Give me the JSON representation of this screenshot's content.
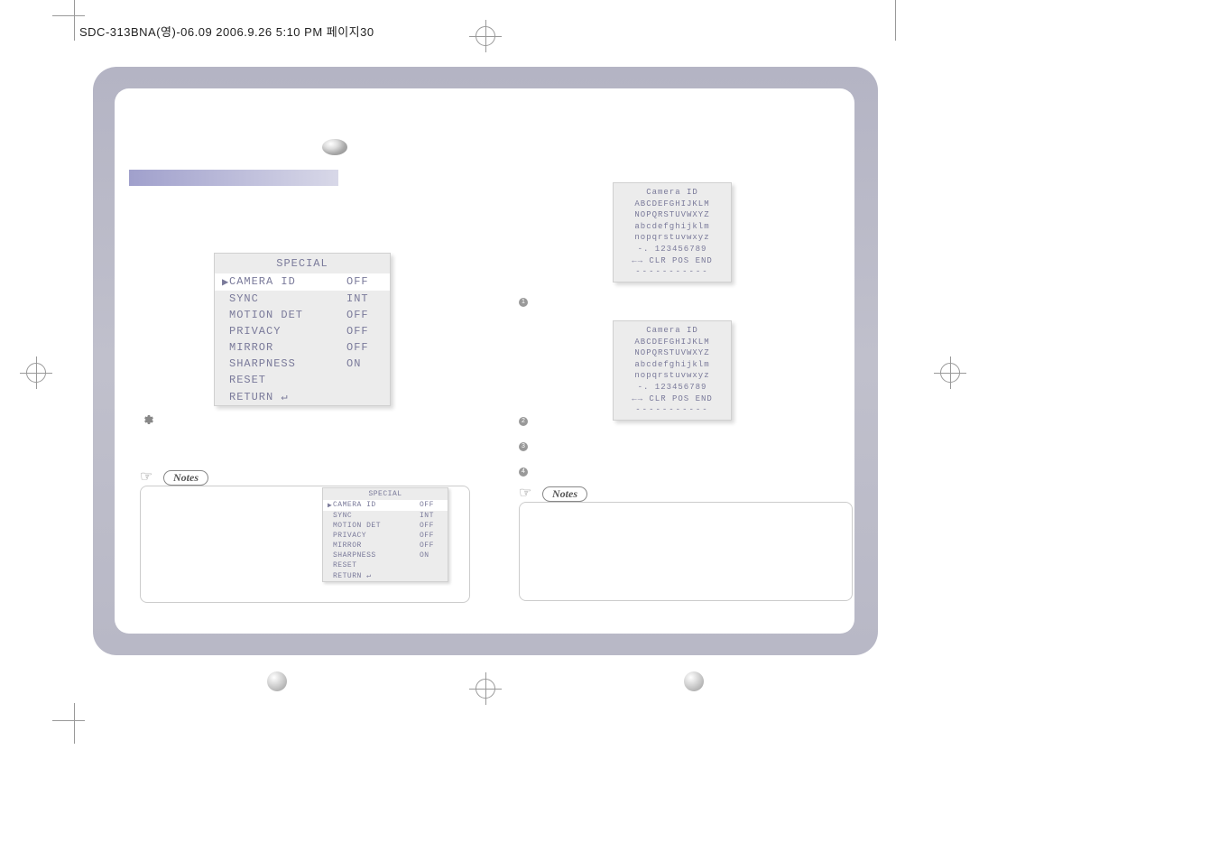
{
  "header": "SDC-313BNA(영)-06.09  2006.9.26 5:10 PM  페이지30",
  "special_menu": {
    "title": "SPECIAL",
    "rows": [
      {
        "label": "CAMERA ID",
        "val": "OFF",
        "selected": true
      },
      {
        "label": "SYNC",
        "val": "INT"
      },
      {
        "label": "MOTION DET",
        "val": "OFF"
      },
      {
        "label": "PRIVACY",
        "val": "OFF"
      },
      {
        "label": "MIRROR",
        "val": "OFF"
      },
      {
        "label": "SHARPNESS",
        "val": "ON"
      },
      {
        "label": "RESET",
        "val": ""
      },
      {
        "label": "RETURN ↵",
        "val": ""
      }
    ]
  },
  "camera_id": {
    "title": "Camera ID",
    "line1": "ABCDEFGHIJKLM",
    "line2": "NOPQRSTUVWXYZ",
    "line3": "abcdefghijklm",
    "line4": "nopqrstuvwxyz",
    "line5": "-.  123456789",
    "line6": "←→ CLR POS END",
    "dashes": "-----------"
  },
  "notes_label": "Notes",
  "bullets": [
    "1",
    "2",
    "3",
    "4"
  ]
}
